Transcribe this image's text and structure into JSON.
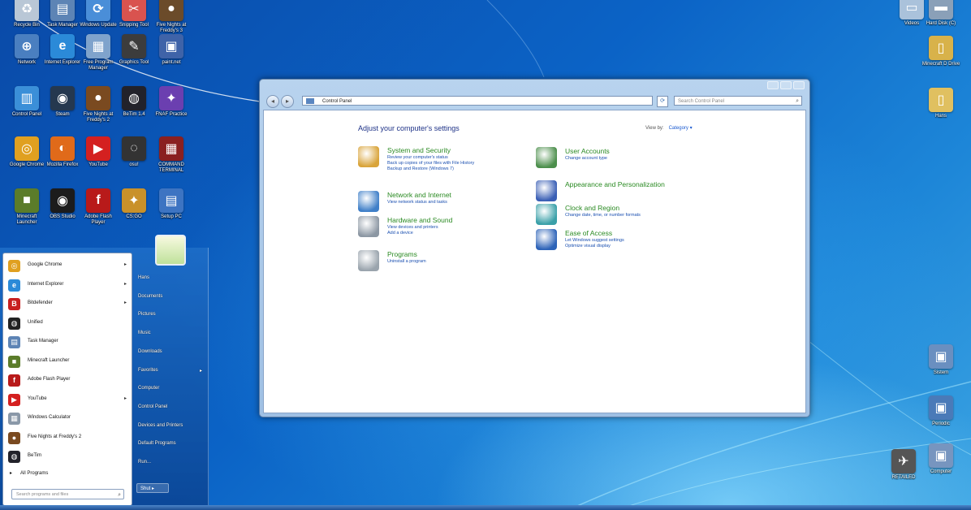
{
  "desktop": {
    "icons": [
      {
        "label": "Recycle Bin",
        "color": "#b9c7d6",
        "glyph": "♻"
      },
      {
        "label": "Task Manager",
        "color": "#5d84b5",
        "glyph": "▤"
      },
      {
        "label": "Windows Update",
        "color": "#4a8ed8",
        "glyph": "⟳"
      },
      {
        "label": "Snipping Tool",
        "color": "#d9534f",
        "glyph": "✂"
      },
      {
        "label": "Five Nights at Freddy's 3",
        "color": "#6b4b2a",
        "glyph": "●"
      },
      {
        "label": "Network",
        "color": "#4a7fc0",
        "glyph": "⊕"
      },
      {
        "label": "Internet Explorer",
        "color": "#2b8ad8",
        "glyph": "e"
      },
      {
        "label": "Free Program Manager",
        "color": "#7fa3cc",
        "glyph": "▦"
      },
      {
        "label": "Graphics Tool",
        "color": "#3c3c3c",
        "glyph": "✎"
      },
      {
        "label": "paint.net",
        "color": "#3f63a8",
        "glyph": "▣"
      },
      {
        "label": "Control Panel",
        "color": "#3b8fd8",
        "glyph": "▥"
      },
      {
        "label": "Steam",
        "color": "#25384f",
        "glyph": "◉"
      },
      {
        "label": "Five Nights at Freddy's 2",
        "color": "#7a4a20",
        "glyph": "●"
      },
      {
        "label": "BeTim 1.4",
        "color": "#22222a",
        "glyph": "◍"
      },
      {
        "label": "FNAF Practice",
        "color": "#6b3fb0",
        "glyph": "✦"
      },
      {
        "label": "Google Chrome",
        "color": "#e0a020",
        "glyph": "◎"
      },
      {
        "label": "Mozilla Firefox",
        "color": "#e06a1a",
        "glyph": "◐"
      },
      {
        "label": "YouTube",
        "color": "#d42020",
        "glyph": "▶"
      },
      {
        "label": "osu!",
        "color": "#333333",
        "glyph": "◌"
      },
      {
        "label": "COMMAND TERMINAL",
        "color": "#8a2020",
        "glyph": "▦"
      },
      {
        "label": "Minecraft Launcher",
        "color": "#5b7c2a",
        "glyph": "■"
      },
      {
        "label": "OBS Studio",
        "color": "#1c1c1c",
        "glyph": "◉"
      },
      {
        "label": "Adobe Flash Player",
        "color": "#b81a1a",
        "glyph": "f"
      },
      {
        "label": "CS:GO",
        "color": "#c9912a",
        "glyph": "✦"
      },
      {
        "label": "Setup PC",
        "color": "#3d74c2",
        "glyph": "▤"
      },
      {
        "label": "Videos",
        "color": "#aac2db",
        "glyph": "▭"
      },
      {
        "label": "Hard Disk (C)",
        "color": "#8aa0b8",
        "glyph": "▬"
      },
      {
        "label": "Minecraft D Drive",
        "color": "#d8b24a",
        "glyph": "▯"
      },
      {
        "label": "Hans",
        "color": "#e0c060",
        "glyph": "▯"
      },
      {
        "label": "Sistem",
        "color": "#6a8fc0",
        "glyph": "▣"
      },
      {
        "label": "Periodic",
        "color": "#4a7ab8",
        "glyph": "▣"
      },
      {
        "label": "RETAILED",
        "color": "#555555",
        "glyph": "✈"
      },
      {
        "label": "Computer",
        "color": "#7795bf",
        "glyph": "▣"
      }
    ]
  },
  "window": {
    "address": "Control Panel",
    "search_placeholder": "Search Control Panel",
    "heading": "Adjust your computer's settings",
    "viewby_label": "View by:",
    "viewby_value": "Category ▾",
    "categories": [
      {
        "title": "System and Security",
        "color": "#d9a43a",
        "links": [
          "Review your computer's status",
          "Back up copies of your files with File History",
          "Backup and Restore (Windows 7)"
        ]
      },
      {
        "title": "Network and Internet",
        "color": "#3f7fc8",
        "links": [
          "View network status and tasks"
        ]
      },
      {
        "title": "Hardware and Sound",
        "color": "#8c97a3",
        "links": [
          "View devices and printers",
          "Add a device"
        ]
      },
      {
        "title": "Programs",
        "color": "#9aa4ad",
        "links": [
          "Uninstall a program"
        ]
      },
      {
        "title": "User Accounts",
        "color": "#4c8f4c",
        "links": [
          "Change account type"
        ]
      },
      {
        "title": "Appearance and Personalization",
        "color": "#3a5fb5",
        "links": []
      },
      {
        "title": "Clock and Region",
        "color": "#3aa0a8",
        "links": [
          "Change date, time, or number formats"
        ]
      },
      {
        "title": "Ease of Access",
        "color": "#2d63b8",
        "links": [
          "Let Windows suggest settings",
          "Optimize visual display"
        ]
      }
    ]
  },
  "startmenu": {
    "programs": [
      {
        "label": "Google Chrome",
        "color": "#e0a020",
        "glyph": "◎",
        "arrow": "▸"
      },
      {
        "label": "Internet Explorer",
        "color": "#2b8ad8",
        "glyph": "e",
        "arrow": "▸"
      },
      {
        "label": "Bitdefender",
        "color": "#c81f1f",
        "glyph": "B",
        "arrow": "▸"
      },
      {
        "label": "Unified",
        "color": "#222222",
        "glyph": "◍",
        "arrow": ""
      },
      {
        "label": "Task Manager",
        "color": "#5d84b5",
        "glyph": "▤",
        "arrow": ""
      },
      {
        "label": "Minecraft Launcher",
        "color": "#5b7c2a",
        "glyph": "■",
        "arrow": ""
      },
      {
        "label": "Adobe Flash Player",
        "color": "#b81a1a",
        "glyph": "f",
        "arrow": ""
      },
      {
        "label": "YouTube",
        "color": "#d42020",
        "glyph": "▶",
        "arrow": "▸"
      },
      {
        "label": "Windows Calculator",
        "color": "#8a98a8",
        "glyph": "▦",
        "arrow": ""
      },
      {
        "label": "Five Nights at Freddy's 2",
        "color": "#7a4a20",
        "glyph": "●",
        "arrow": ""
      },
      {
        "label": "BeTim",
        "color": "#22222a",
        "glyph": "◍",
        "arrow": ""
      }
    ],
    "all_programs": "All Programs",
    "search_placeholder": "Search programs and files",
    "right_items": [
      {
        "label": "Hans",
        "arrow": ""
      },
      {
        "label": "Documents",
        "arrow": ""
      },
      {
        "label": "Pictures",
        "arrow": ""
      },
      {
        "label": "Music",
        "arrow": ""
      },
      {
        "label": "Downloads",
        "arrow": ""
      },
      {
        "label": "Favorites",
        "arrow": "▸"
      },
      {
        "label": "Computer",
        "arrow": ""
      },
      {
        "label": "Control Panel",
        "arrow": ""
      },
      {
        "label": "Devices and Printers",
        "arrow": ""
      },
      {
        "label": "Default Programs",
        "arrow": ""
      },
      {
        "label": "Run...",
        "arrow": ""
      }
    ],
    "shutdown_label": "Shut"
  }
}
